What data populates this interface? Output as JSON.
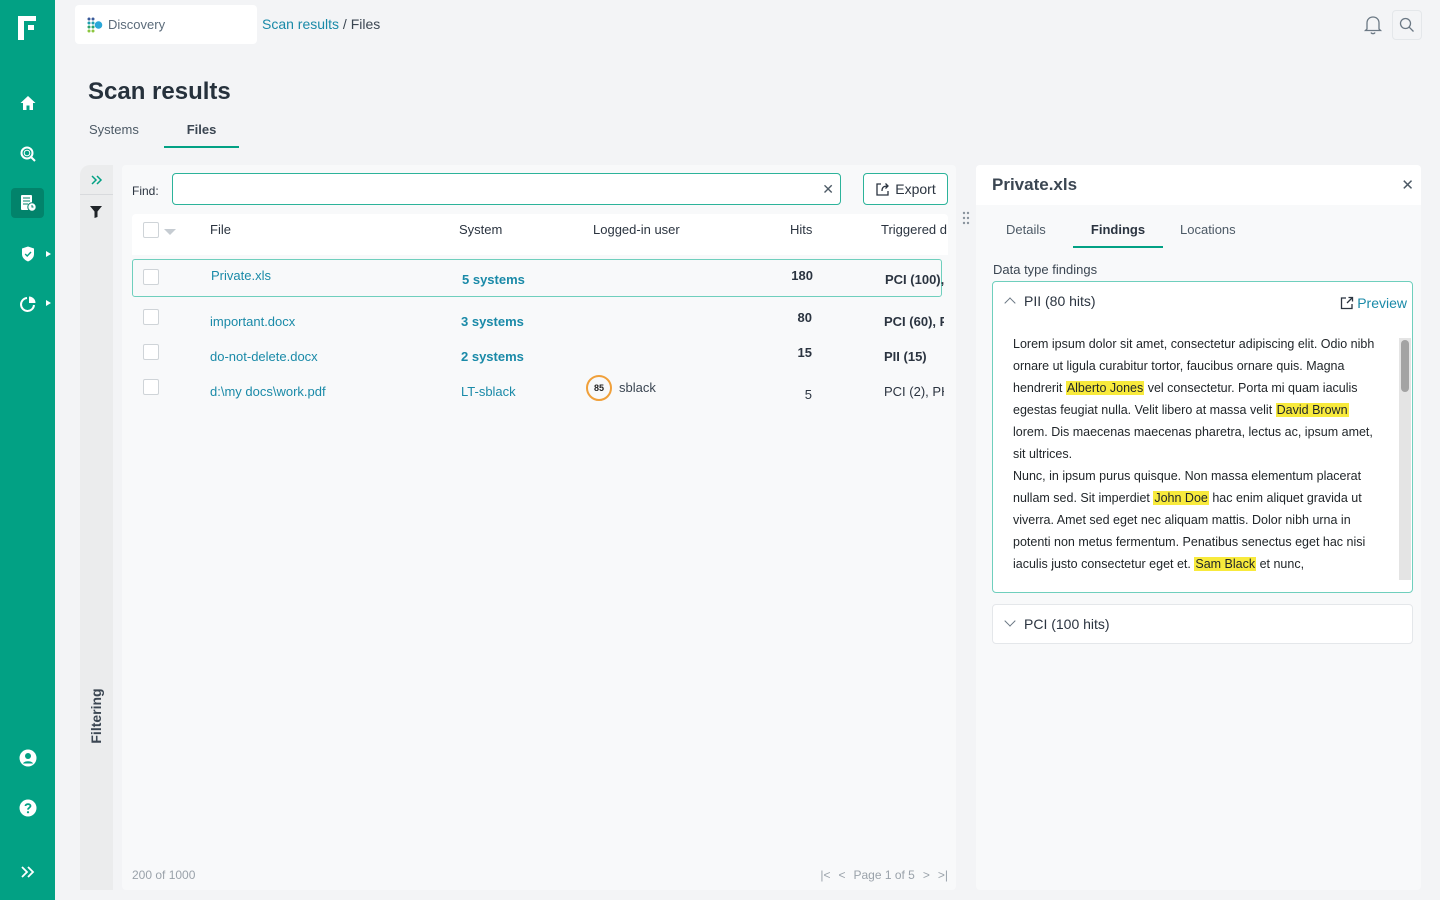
{
  "nav": {
    "items": [
      {
        "name": "home",
        "icon": "home-icon"
      },
      {
        "name": "discovery-search",
        "icon": "scan-search-icon"
      },
      {
        "name": "scan-results",
        "icon": "report-clock-icon",
        "active": true
      },
      {
        "name": "protection",
        "icon": "shield-check-icon",
        "has_submenu": true
      },
      {
        "name": "reports",
        "icon": "pie-chart-icon",
        "has_submenu": true
      }
    ],
    "bottom": [
      {
        "name": "account",
        "icon": "user-circle-icon"
      },
      {
        "name": "help",
        "icon": "help-circle-icon"
      },
      {
        "name": "expand",
        "icon": "double-chevron-right-icon"
      }
    ],
    "brand_color": "#02a184"
  },
  "topbar": {
    "app_label": "Discovery",
    "breadcrumb": {
      "parent": "Scan results",
      "separator": " / ",
      "current": "Files"
    }
  },
  "page": {
    "title": "Scan results",
    "tabs": [
      {
        "label": "Systems",
        "active": false
      },
      {
        "label": "Files",
        "active": true
      }
    ]
  },
  "filter_strip": {
    "label": "Filtering"
  },
  "toolbar": {
    "find_label": "Find:",
    "find_value": "",
    "find_placeholder": "",
    "export_label": "Export"
  },
  "table": {
    "columns": [
      "File",
      "System",
      "Logged-in user",
      "Hits",
      "Triggered d"
    ],
    "rows": [
      {
        "file": "Private.xls",
        "system": "5 systems",
        "user": "",
        "risk": "",
        "hits": "180",
        "triggered": "PCI (100),",
        "selected": true
      },
      {
        "file": "important.docx",
        "system": "3 systems",
        "user": "",
        "risk": "",
        "hits": "80",
        "triggered": "PCI (60), P",
        "selected": false
      },
      {
        "file": "do-not-delete.docx",
        "system": "2 systems",
        "user": "",
        "risk": "",
        "hits": "15",
        "triggered": "PII (15)",
        "selected": false
      },
      {
        "file": "d:\\my docs\\work.pdf",
        "system": "LT-sblack",
        "user": "sblack",
        "risk": "85",
        "hits": "5",
        "triggered": "PCI (2), PH",
        "selected": false
      }
    ],
    "footer_count": "200 of 1000",
    "pager": {
      "label": "Page 1 of 5",
      "current": 1,
      "total": 5
    }
  },
  "detail": {
    "title": "Private.xls",
    "tabs": [
      {
        "label": "Details",
        "active": false
      },
      {
        "label": "Findings",
        "active": true
      },
      {
        "label": "Locations",
        "active": false
      }
    ],
    "section_label": "Data type findings",
    "accordions": [
      {
        "title": "PII (80 hits)",
        "expanded": true,
        "preview_label": "Preview",
        "preview_segments": [
          {
            "t": "Lorem ipsum dolor sit amet, consectetur adipiscing elit. Odio nibh ornare ut ligula curabitur tortor, faucibus ornare quis. Magna hendrerit "
          },
          {
            "t": "Alberto Jones",
            "hl": true
          },
          {
            "t": " vel consectetur. Porta mi quam iaculis egestas feugiat nulla. Velit libero at massa velit "
          },
          {
            "t": "David Brown",
            "hl": true
          },
          {
            "t": " lorem. Dis maecenas maecenas pharetra, lectus ac, ipsum amet, sit ultrices."
          },
          {
            "br": true
          },
          {
            "t": "Nunc, in ipsum purus quisque. Non massa elementum placerat nullam sed. Sit imperdiet "
          },
          {
            "t": "John Doe",
            "hl": true
          },
          {
            "t": " hac enim aliquet gravida ut viverra. Amet sed eget nec aliquam mattis. Dolor nibh urna in potenti non metus fermentum. Penatibus senectus eget hac nisi iaculis justo consectetur eget et. "
          },
          {
            "t": "Sam Black",
            "hl": true
          },
          {
            "t": " et nunc,"
          }
        ],
        "highlight_color": "#f8ea3c"
      },
      {
        "title": "PCI (100 hits)",
        "expanded": false
      }
    ]
  }
}
